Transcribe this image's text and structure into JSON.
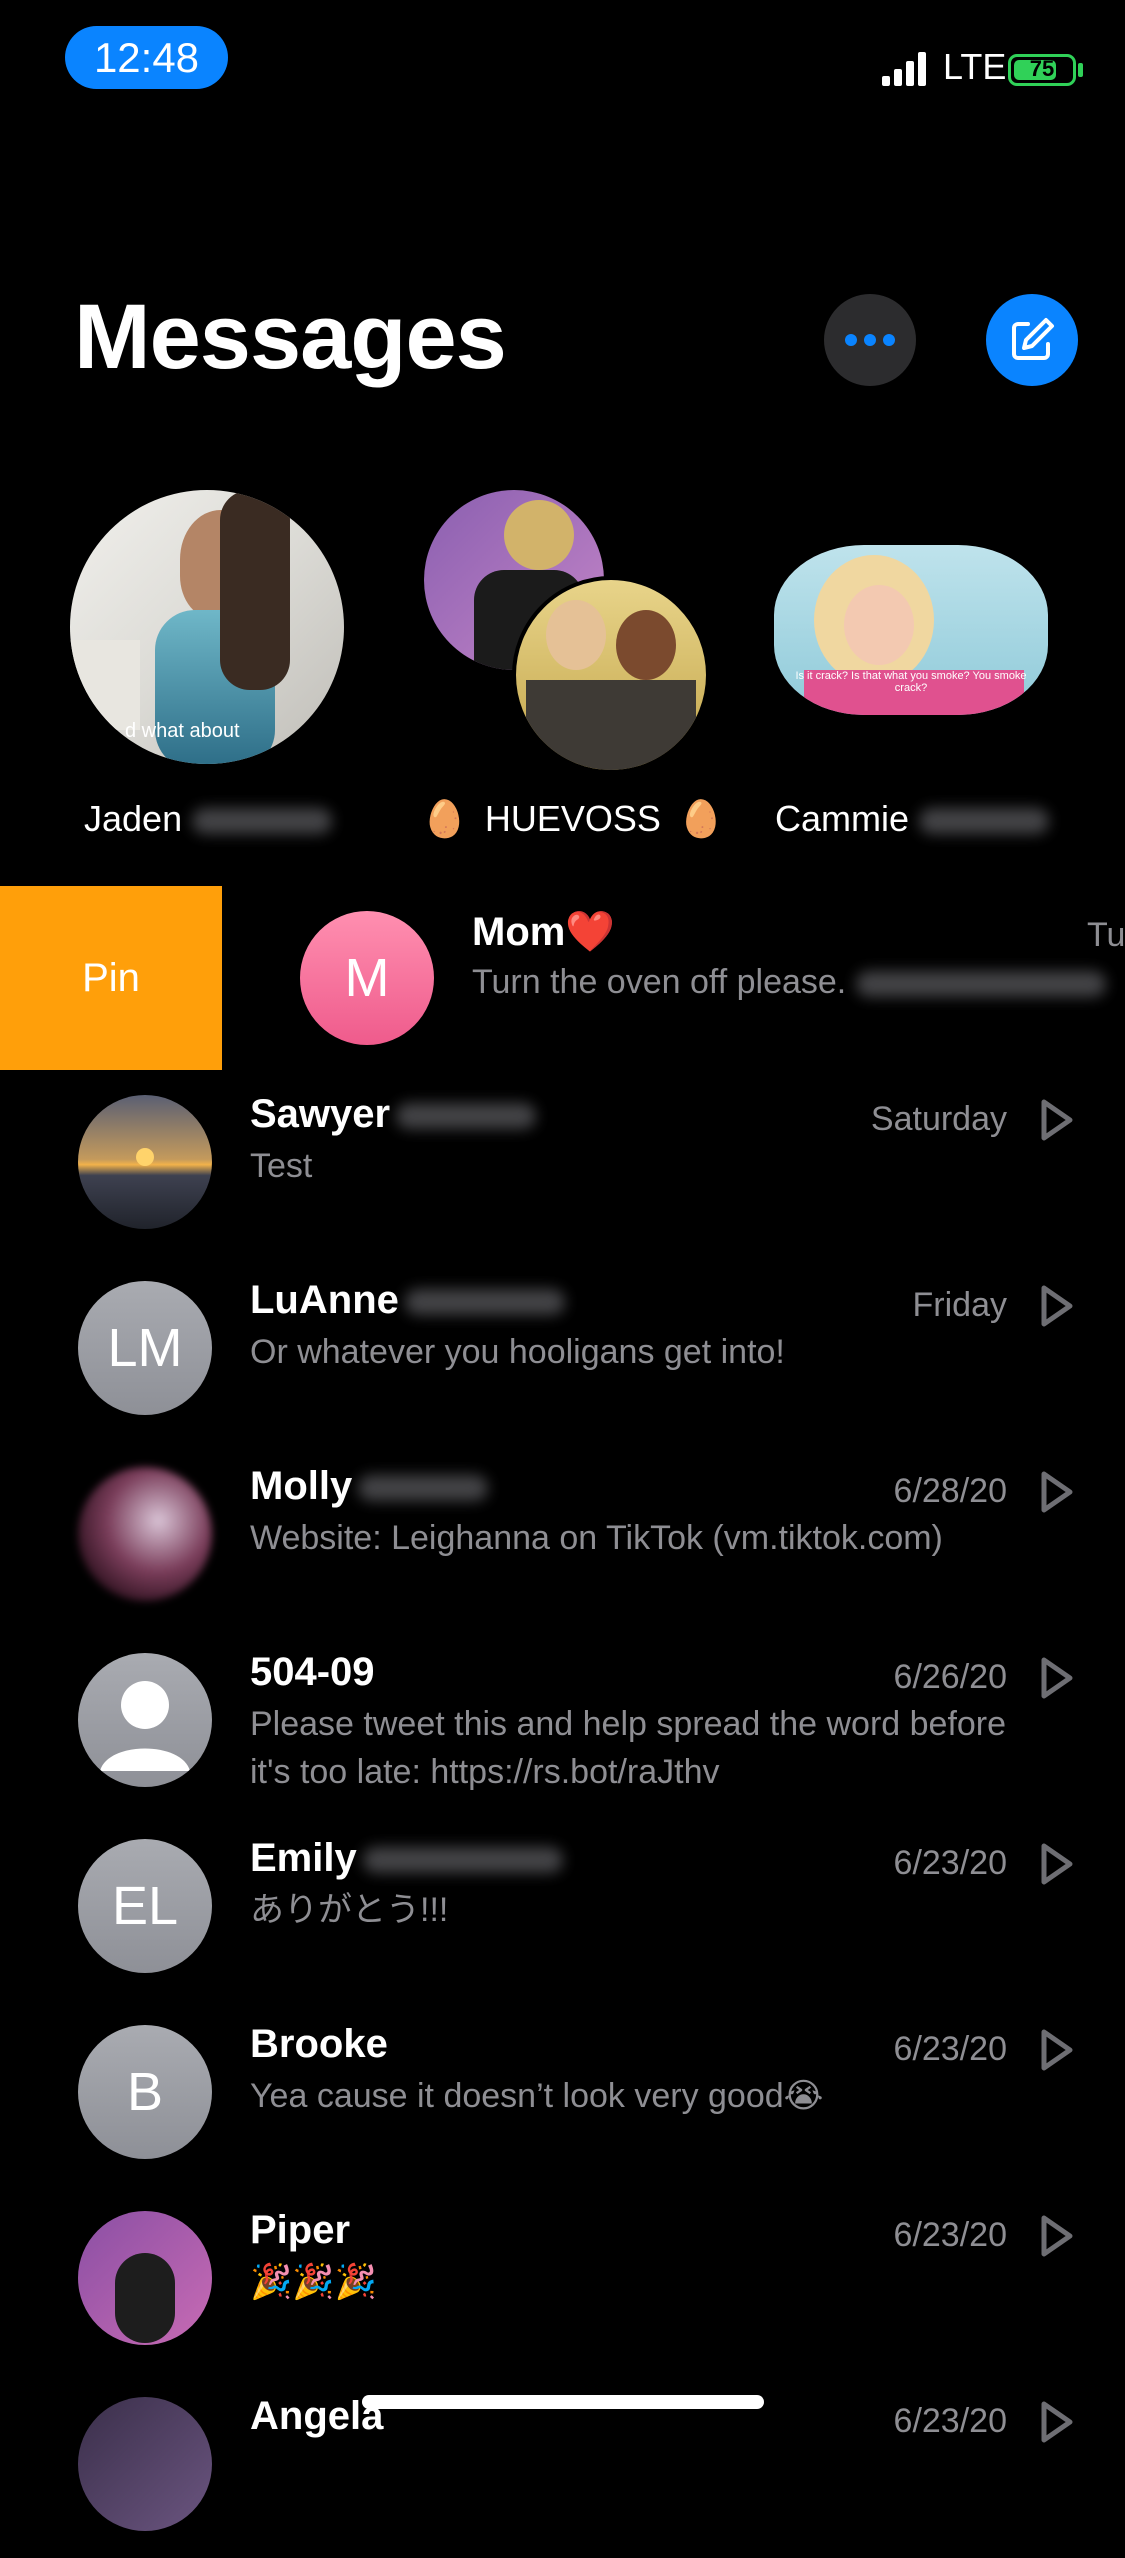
{
  "status": {
    "time": "12:48",
    "network": "LTE",
    "battery": "75",
    "battery_level": 0.75
  },
  "header": {
    "title": "Messages",
    "more_icon": "ellipsis-icon",
    "compose_icon": "compose-icon"
  },
  "pinned": [
    {
      "name": "Jaden",
      "caption": "d what about"
    },
    {
      "name": "HUEVOSS",
      "emoji": "🥚"
    },
    {
      "name": "Cammie",
      "caption": "Is it crack? Is that what you smoke? You smoke crack?"
    }
  ],
  "swiped_row": {
    "action": "Pin",
    "initial": "M",
    "name": "Mom",
    "emoji": "❤️",
    "preview": "Turn the oven off please.",
    "date": "Tu"
  },
  "conversations": [
    {
      "name": "Sawyer",
      "preview": "Test",
      "date": "Saturday",
      "avatar": "sunset-photo"
    },
    {
      "name": "LuAnne",
      "preview": "Or whatever you hooligans get into!",
      "date": "Friday",
      "initials": "LM"
    },
    {
      "name": "Molly",
      "preview": "Website: Leighanna on TikTok (vm.tiktok.com)",
      "date": "6/28/20",
      "avatar": "blurred-photo"
    },
    {
      "name": "504-09",
      "preview": "Please tweet this and help spread the word before it's too late: https://rs.bot/raJthv",
      "date": "6/26/20",
      "avatar": "person-silhouette"
    },
    {
      "name": "Emily",
      "preview": "ありがとう!!!",
      "date": "6/23/20",
      "initials": "EL"
    },
    {
      "name": "Brooke",
      "preview": "Yea cause it doesn’t look very good😭",
      "date": "6/23/20",
      "initials": "B"
    },
    {
      "name": "Piper",
      "preview": "🎉🎉🎉",
      "date": "6/23/20",
      "avatar": "photo"
    },
    {
      "name": "Angela",
      "preview": "",
      "date": "6/23/20",
      "avatar": "photo"
    }
  ]
}
